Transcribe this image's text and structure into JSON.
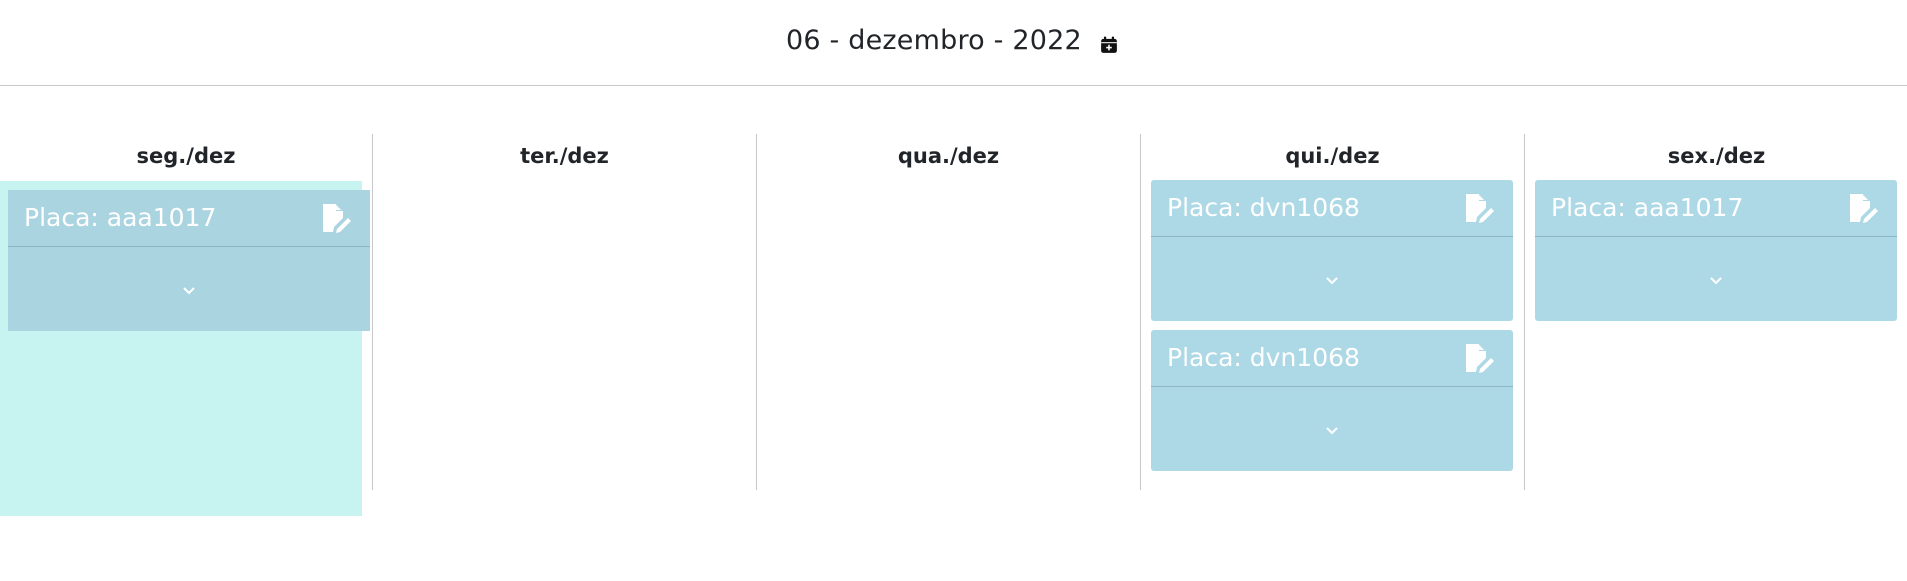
{
  "header": {
    "date_title": "06 - dezembro - 2022",
    "calendar_icon": "calendar-plus-icon"
  },
  "days": [
    {
      "label": "seg./dez"
    },
    {
      "label": "ter./dez"
    },
    {
      "label": "qua./dez"
    },
    {
      "label": "qui./dez"
    },
    {
      "label": "sex./dez"
    }
  ],
  "cards": {
    "seg": [
      {
        "placa": "Placa: aaa1017"
      }
    ],
    "qui": [
      {
        "placa": "Placa: dvn1068"
      },
      {
        "placa": "Placa: dvn1068"
      }
    ],
    "sex": [
      {
        "placa": "Placa: aaa1017"
      }
    ]
  },
  "icons": {
    "edit": "file-edit-icon",
    "expand": "chevron-down-icon"
  },
  "colors": {
    "card_bg": "#add8e6",
    "drop_highlight": "#c7f4f0",
    "card_text": "#ffffff"
  }
}
